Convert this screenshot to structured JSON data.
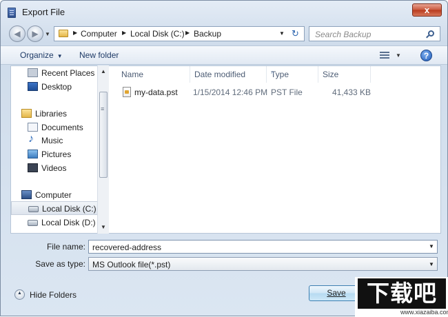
{
  "window": {
    "title": "Export File",
    "close_glyph": "x"
  },
  "nav_buttons": {
    "back_glyph": "◀",
    "forward_glyph": "▶"
  },
  "address_bar": {
    "crumbs": [
      "Computer",
      "Local Disk (C:)",
      "Backup"
    ],
    "separator": "▶",
    "refresh_glyph": "↻"
  },
  "search": {
    "placeholder": "Search Backup"
  },
  "toolbar": {
    "organize_label": "Organize",
    "new_folder_label": "New folder",
    "help_glyph": "?",
    "dropdown_glyph": "▼"
  },
  "nav_pane": {
    "items": [
      {
        "label": "Recent Places",
        "icon": "recent-places-icon"
      },
      {
        "label": "Desktop",
        "icon": "desktop-icon"
      },
      {
        "label": "Libraries",
        "icon": "libraries-icon"
      },
      {
        "label": "Documents",
        "icon": "documents-icon"
      },
      {
        "label": "Music",
        "icon": "music-icon"
      },
      {
        "label": "Pictures",
        "icon": "pictures-icon"
      },
      {
        "label": "Videos",
        "icon": "videos-icon"
      },
      {
        "label": "Computer",
        "icon": "computer-icon"
      },
      {
        "label": "Local Disk (C:)",
        "icon": "disk-icon",
        "selected": true
      },
      {
        "label": "Local Disk (D:)",
        "icon": "disk-icon"
      }
    ],
    "scroll_up_glyph": "▲",
    "scroll_down_glyph": "▼",
    "scroll_grip_glyph": "≡"
  },
  "file_list": {
    "columns": [
      "Name",
      "Date modified",
      "Type",
      "Size"
    ],
    "sort_glyph": "˄",
    "rows": [
      {
        "name": "my-data.pst",
        "date_modified": "1/15/2014 12:46 PM",
        "type": "PST File",
        "size": "41,433 KB"
      }
    ]
  },
  "form": {
    "file_name_label": "File name:",
    "file_name_value": "recovered-address",
    "save_as_type_label": "Save as type:",
    "save_as_type_value": "MS Outlook file(*.pst)"
  },
  "footer": {
    "hide_folders_label": "Hide Folders",
    "save_label": "Save"
  },
  "watermark": {
    "logo_text": "下载吧",
    "url": "www.xiazaiba.com"
  },
  "colors": {
    "accent": "#1e3a66",
    "close": "#c9573c",
    "save_border": "#3c7fb1"
  }
}
